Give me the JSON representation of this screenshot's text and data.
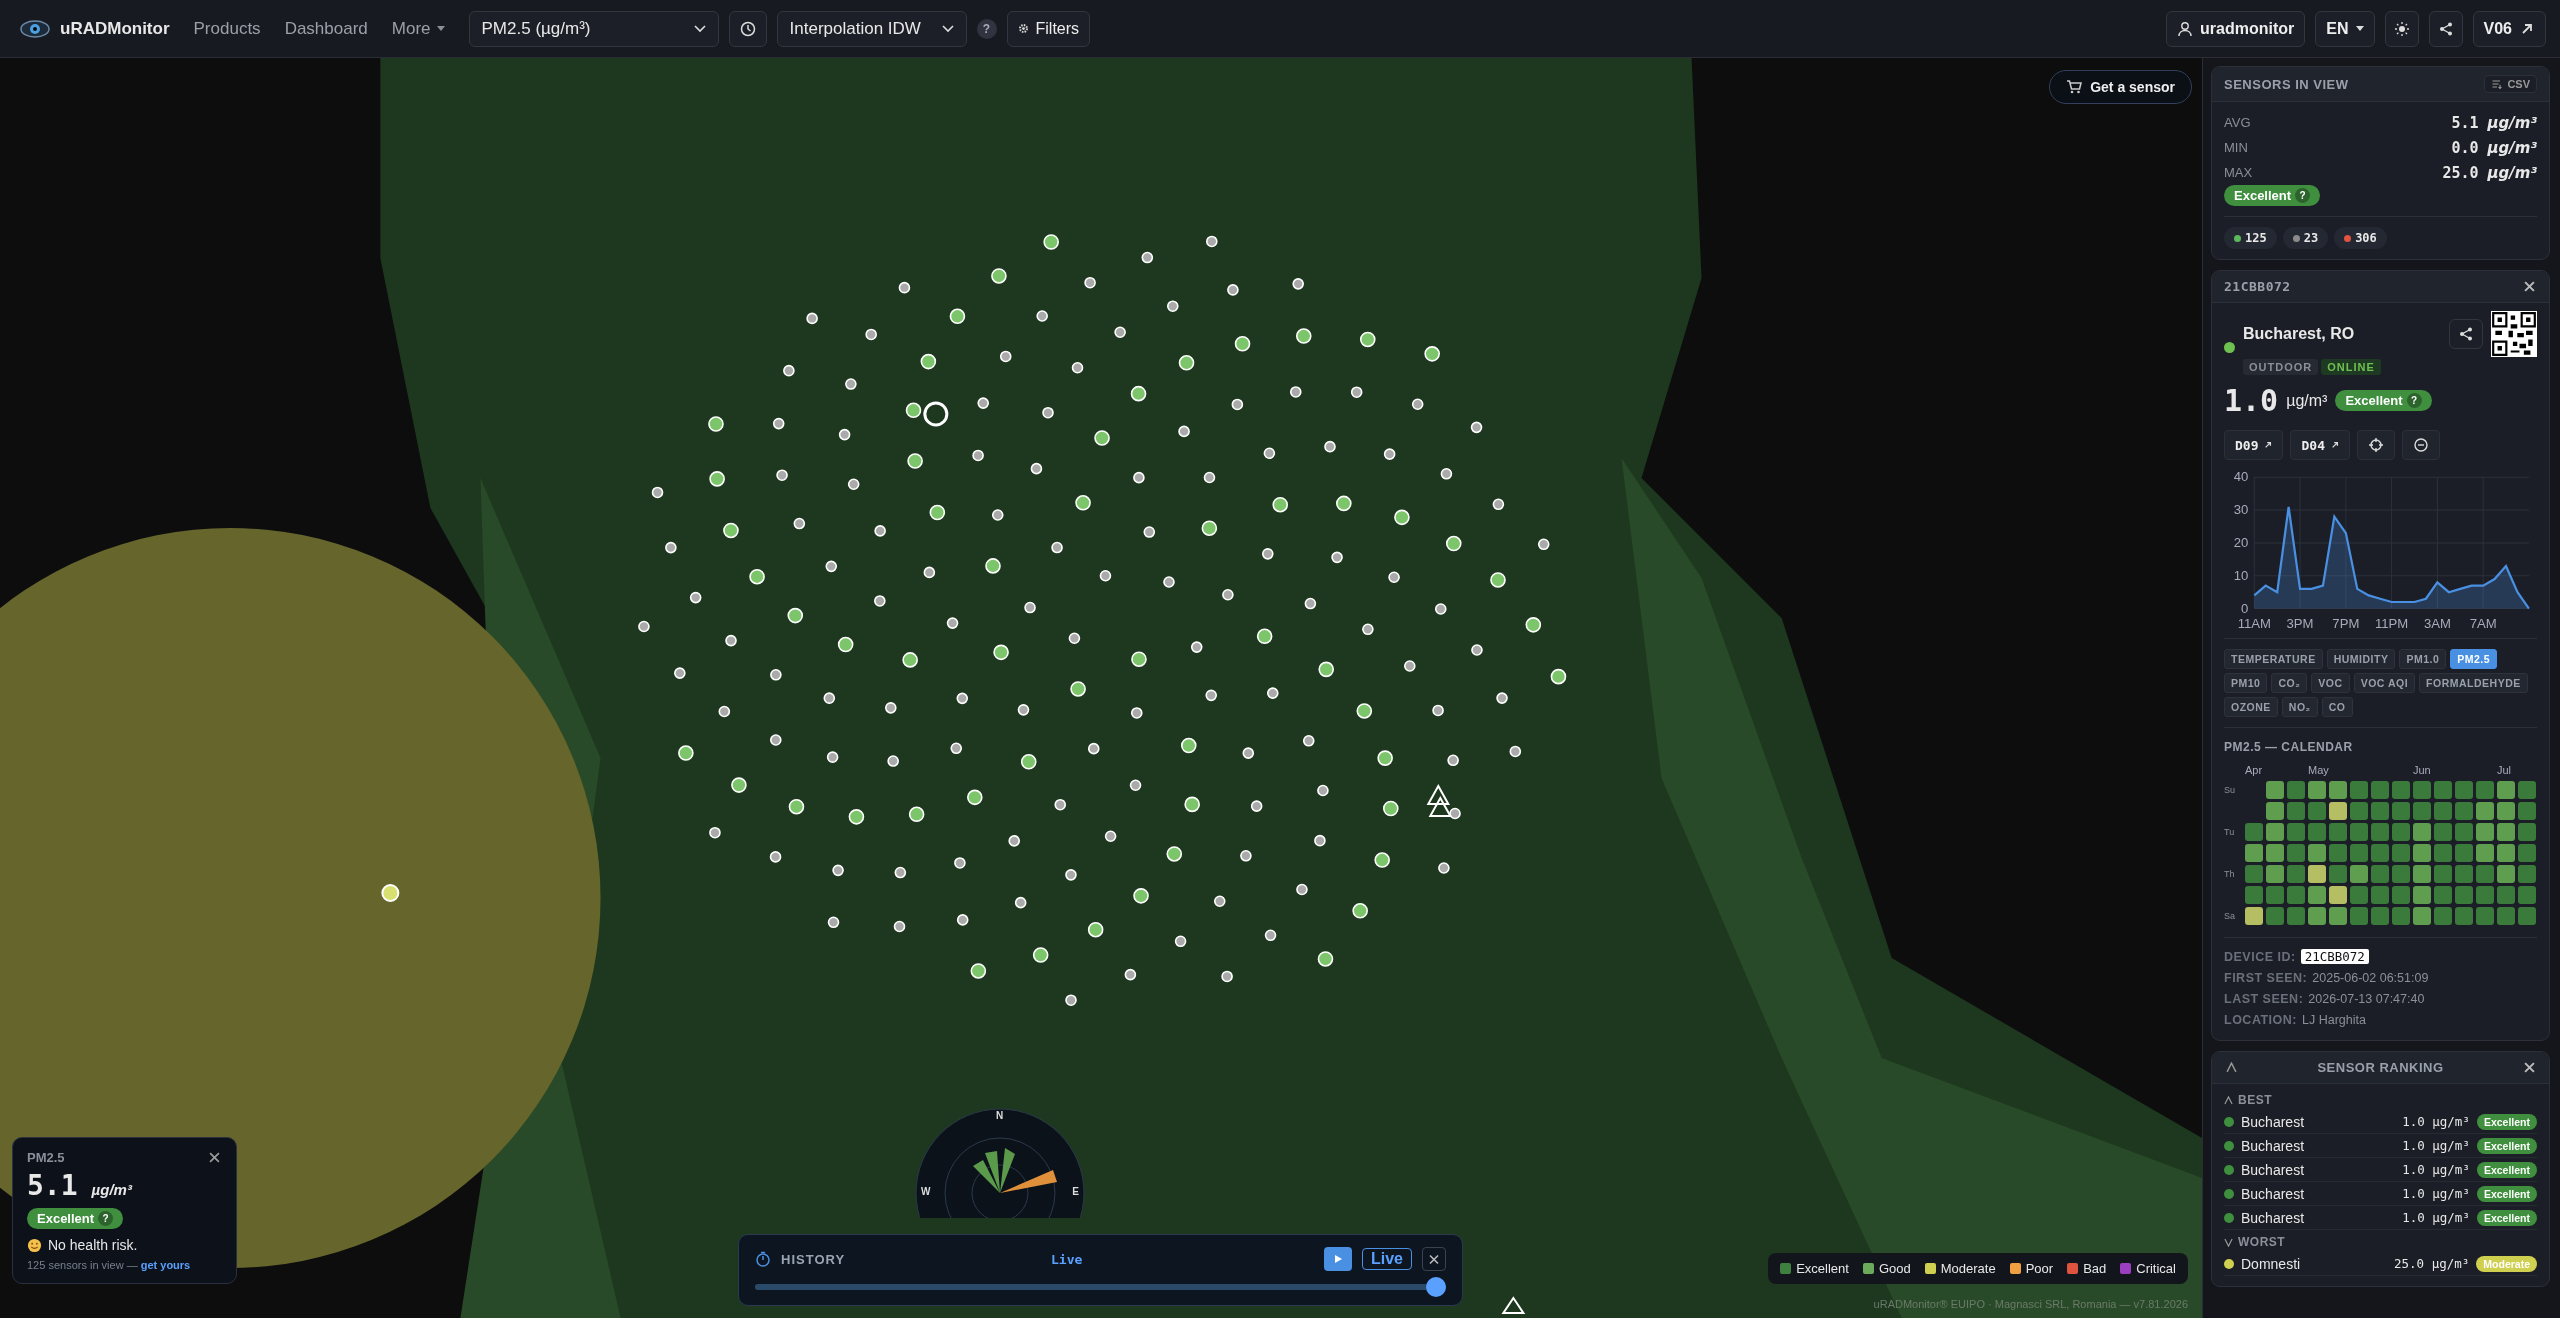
{
  "topbar": {
    "brand": "uRADMonitor",
    "nav": [
      {
        "label": "Products",
        "dropdown": false
      },
      {
        "label": "Dashboard",
        "dropdown": false
      },
      {
        "label": "More",
        "dropdown": true
      }
    ],
    "parameter_select": "PM2.5 (µg/m³)",
    "interpolation_select": "Interpolation IDW",
    "help": "?",
    "filters": "Filters",
    "user": "uradmonitor",
    "language": "EN",
    "version": "V06"
  },
  "map": {
    "get_sensor": "Get a sensor",
    "compass": [
      "N",
      "W",
      "E"
    ],
    "summary_card": {
      "parameter": "PM2.5",
      "value": "5.1",
      "unit": "µg/m³",
      "rating": {
        "label": "Excellent",
        "color": "#3f8f3f"
      },
      "help": "?",
      "health": "No health risk.",
      "sensors_text": "125 sensors in view — ",
      "link": "get yours"
    },
    "history": {
      "title": "HISTORY",
      "mode": "Live",
      "live_button": "Live",
      "level": 1
    },
    "legend": [
      {
        "label": "Excellent",
        "color": "#3f7f3f"
      },
      {
        "label": "Good",
        "color": "#6aaa5a"
      },
      {
        "label": "Moderate",
        "color": "#d0d050"
      },
      {
        "label": "Poor",
        "color": "#f0a040"
      },
      {
        "label": "Bad",
        "color": "#e0533f"
      },
      {
        "label": "Critical",
        "color": "#9b3fc0"
      }
    ],
    "attribution": "uRADMonitor® EUIPO · Magnasci SRL, Romania — v7.81.2026"
  },
  "panel": {
    "sensors_in_view": {
      "title": "SENSORS IN VIEW",
      "csv": "CSV",
      "stats": [
        {
          "label": "AVG",
          "value": "5.1",
          "unit": "µg/m³"
        },
        {
          "label": "MIN",
          "value": "0.0",
          "unit": "µg/m³"
        },
        {
          "label": "MAX",
          "value": "25.0",
          "unit": "µg/m³"
        }
      ],
      "rating": {
        "label": "Excellent",
        "color": "#3f8f3f"
      },
      "help": "?",
      "counts": [
        {
          "count": "125",
          "color": "#5cb85c"
        },
        {
          "count": "23",
          "color": "#8a8a8a"
        },
        {
          "count": "306",
          "color": "#e0533f"
        }
      ]
    },
    "device": {
      "id": "21CBB072",
      "online": true,
      "location": "Bucharest, RO",
      "tags": [
        {
          "label": "OUTDOOR",
          "kind": "plain"
        },
        {
          "label": "ONLINE",
          "kind": "status"
        }
      ],
      "value": "1.0",
      "unit": "µg/m³",
      "rating": {
        "label": "Excellent",
        "color": "#3f8f3f"
      },
      "help": "?",
      "links": [
        "D09",
        "D04"
      ],
      "chart_data": {
        "type": "area",
        "categories": [
          "11AM",
          null,
          null,
          null,
          "3PM",
          null,
          null,
          null,
          "7PM",
          null,
          null,
          null,
          "11PM",
          null,
          null,
          null,
          "3AM",
          null,
          null,
          null,
          "7AM",
          null,
          null,
          null,
          null
        ],
        "series": [
          {
            "color": "#4a90e2",
            "values": [
              4,
              7,
              5,
              31,
              6,
              6,
              7,
              28,
              23,
              6,
              4,
              3,
              2,
              2,
              2,
              3,
              8,
              5,
              6,
              7,
              7,
              9,
              13,
              5,
              0
            ]
          }
        ],
        "yticks": [
          0,
          10,
          20,
          30,
          40
        ],
        "ylim": [
          0,
          40
        ],
        "grid": true
      },
      "parameters": [
        {
          "label": "TEMPERATURE",
          "selected": false
        },
        {
          "label": "HUMIDITY",
          "selected": false
        },
        {
          "label": "PM1.0",
          "selected": false
        },
        {
          "label": "PM2.5",
          "selected": true
        },
        {
          "label": "PM10",
          "selected": false
        },
        {
          "label": "CO₂",
          "selected": false
        },
        {
          "label": "VOC",
          "selected": false
        },
        {
          "label": "VOC AQI",
          "selected": false
        },
        {
          "label": "FORMALDEHYDE",
          "selected": false
        },
        {
          "label": "OZONE",
          "selected": false
        },
        {
          "label": "NO₂",
          "selected": false
        },
        {
          "label": "CO",
          "selected": false
        }
      ],
      "calendar": {
        "title": "PM2.5 — CALENDAR",
        "day_labels": [
          "Su",
          "Tu",
          "Th",
          "Sa"
        ],
        "weeks": [
          {
            "month": "Apr",
            "days": [
              {
                "color": "#3a7a3a"
              },
              {
                "color": "#5e9e4e"
              },
              {
                "color": "#3a7a3a"
              },
              {
                "color": "#3a7a3a"
              },
              {
                "color": "#b5be62"
              }
            ]
          },
          {
            "days": [
              {
                "color": "#5e9e4e"
              },
              {
                "color": "#5e9e4e"
              },
              {
                "color": "#5e9e4e"
              },
              {
                "color": "#5e9e4e"
              },
              {
                "color": "#5e9e4e"
              },
              {
                "color": "#3a7a3a"
              },
              {
                "color": "#3a7a3a"
              }
            ]
          },
          {
            "days": [
              {
                "color": "#3a7a3a"
              },
              {
                "color": "#3a7a3a"
              },
              {
                "color": "#3a7a3a"
              },
              {
                "color": "#3a7a3a"
              },
              {
                "color": "#3a7a3a"
              },
              {
                "color": "#3a7a3a"
              },
              {
                "color": "#3a7a3a"
              }
            ]
          },
          {
            "month": "May",
            "days": [
              {
                "color": "#5e9e4e"
              },
              {
                "color": "#3a7a3a"
              },
              {
                "color": "#3a7a3a"
              },
              {
                "color": "#5e9e4e"
              },
              {
                "color": "#b5be62"
              },
              {
                "color": "#5e9e4e"
              },
              {
                "color": "#5e9e4e"
              }
            ]
          },
          {
            "days": [
              {
                "color": "#5e9e4e"
              },
              {
                "color": "#b5be62"
              },
              {
                "color": "#3a7a3a"
              },
              {
                "color": "#3a7a3a"
              },
              {
                "color": "#3a7a3a"
              },
              {
                "color": "#b5be62"
              },
              {
                "color": "#5e9e4e"
              }
            ]
          },
          {
            "days": [
              {
                "color": "#3a7a3a"
              },
              {
                "color": "#3a7a3a"
              },
              {
                "color": "#3a7a3a"
              },
              {
                "color": "#3a7a3a"
              },
              {
                "color": "#5e9e4e"
              },
              {
                "color": "#3a7a3a"
              },
              {
                "color": "#3a7a3a"
              }
            ]
          },
          {
            "days": [
              {
                "color": "#3a7a3a"
              },
              {
                "color": "#3a7a3a"
              },
              {
                "color": "#3a7a3a"
              },
              {
                "color": "#3a7a3a"
              },
              {
                "color": "#3a7a3a"
              },
              {
                "color": "#3a7a3a"
              },
              {
                "color": "#3a7a3a"
              }
            ]
          },
          {
            "days": [
              {
                "color": "#3a7a3a"
              },
              {
                "color": "#3a7a3a"
              },
              {
                "color": "#3a7a3a"
              },
              {
                "color": "#3a7a3a"
              },
              {
                "color": "#3a7a3a"
              },
              {
                "color": "#3a7a3a"
              },
              {
                "color": "#3a7a3a"
              }
            ]
          },
          {
            "month": "Jun",
            "days": [
              {
                "color": "#3a7a3a"
              },
              {
                "color": "#3a7a3a"
              },
              {
                "color": "#5e9e4e"
              },
              {
                "color": "#5e9e4e"
              },
              {
                "color": "#5e9e4e"
              },
              {
                "color": "#5e9e4e"
              },
              {
                "color": "#5e9e4e"
              }
            ]
          },
          {
            "days": [
              {
                "color": "#3a7a3a"
              },
              {
                "color": "#3a7a3a"
              },
              {
                "color": "#3a7a3a"
              },
              {
                "color": "#3a7a3a"
              },
              {
                "color": "#3a7a3a"
              },
              {
                "color": "#3a7a3a"
              },
              {
                "color": "#3a7a3a"
              }
            ]
          },
          {
            "days": [
              {
                "color": "#3a7a3a"
              },
              {
                "color": "#3a7a3a"
              },
              {
                "color": "#3a7a3a"
              },
              {
                "color": "#3a7a3a"
              },
              {
                "color": "#3a7a3a"
              },
              {
                "color": "#3a7a3a"
              },
              {
                "color": "#3a7a3a"
              }
            ]
          },
          {
            "days": [
              {
                "color": "#3a7a3a"
              },
              {
                "color": "#5e9e4e"
              },
              {
                "color": "#5e9e4e"
              },
              {
                "color": "#5e9e4e"
              },
              {
                "color": "#3a7a3a"
              },
              {
                "color": "#3a7a3a"
              },
              {
                "color": "#3a7a3a"
              }
            ]
          },
          {
            "month": "Jul",
            "days": [
              {
                "color": "#5e9e4e"
              },
              {
                "color": "#5e9e4e"
              },
              {
                "color": "#5e9e4e"
              },
              {
                "color": "#5e9e4e"
              },
              {
                "color": "#5e9e4e"
              },
              {
                "color": "#3a7a3a"
              },
              {
                "color": "#3a7a3a"
              }
            ]
          },
          {
            "days": [
              {
                "color": "#3a7a3a"
              },
              {
                "color": "#3a7a3a"
              },
              {
                "color": "#3a7a3a"
              },
              {
                "color": "#3a7a3a"
              },
              {
                "color": "#3a7a3a"
              },
              {
                "color": "#3a7a3a"
              },
              {
                "color": "#3a7a3a"
              }
            ]
          }
        ]
      },
      "info": [
        {
          "label": "DEVICE ID:",
          "value": "21CBB072",
          "kind": "code"
        },
        {
          "label": "FIRST SEEN:",
          "value": "2025-06-02 06:51:09",
          "kind": "text"
        },
        {
          "label": "LAST SEEN:",
          "value": "2026-07-13 07:47:40",
          "kind": "text"
        },
        {
          "label": "LOCATION:",
          "value": "LJ Harghita",
          "kind": "text"
        }
      ]
    },
    "ranking": {
      "title": "SENSOR RANKING",
      "groups": [
        {
          "label": "BEST",
          "kind": "best",
          "rows": [
            {
              "name": "Bucharest",
              "value": "1.0",
              "unit": "µg/m³",
              "rating": "Excellent",
              "color": "#3f8f3f"
            },
            {
              "name": "Bucharest",
              "value": "1.0",
              "unit": "µg/m³",
              "rating": "Excellent",
              "color": "#3f8f3f"
            },
            {
              "name": "Bucharest",
              "value": "1.0",
              "unit": "µg/m³",
              "rating": "Excellent",
              "color": "#3f8f3f"
            },
            {
              "name": "Bucharest",
              "value": "1.0",
              "unit": "µg/m³",
              "rating": "Excellent",
              "color": "#3f8f3f"
            },
            {
              "name": "Bucharest",
              "value": "1.0",
              "unit": "µg/m³",
              "rating": "Excellent",
              "color": "#3f8f3f"
            }
          ]
        },
        {
          "label": "WORST",
          "kind": "worst",
          "rows": [
            {
              "name": "Domnesti",
              "value": "25.0",
              "unit": "µg/m³",
              "rating": "Moderate",
              "color": "#d0d050"
            }
          ]
        }
      ]
    }
  }
}
